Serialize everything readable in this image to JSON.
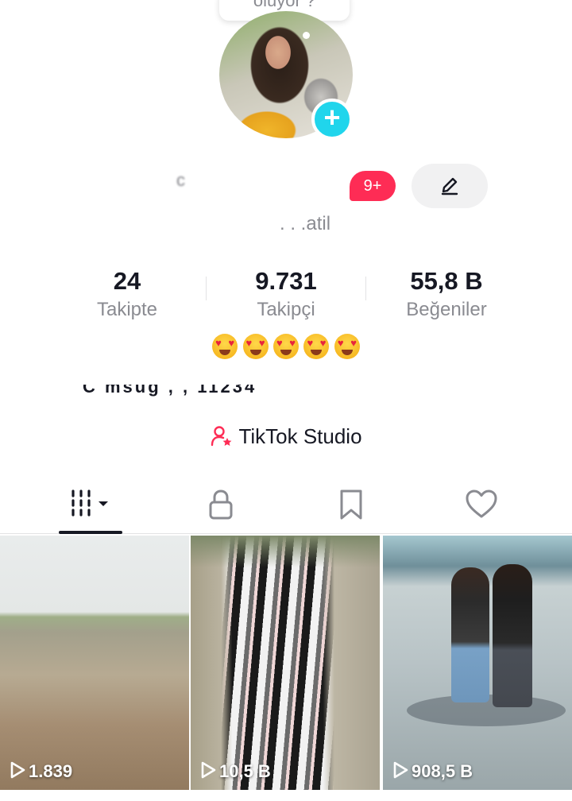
{
  "profile": {
    "note_bubble": "oluyor ?",
    "username": "c   ",
    "notification_badge": "9+",
    "subname": ". . .atil"
  },
  "stats": [
    {
      "value": "24",
      "label": "Takipte"
    },
    {
      "value": "9.731",
      "label": "Takipçi"
    },
    {
      "value": "55,8 B",
      "label": "Beğeniler"
    }
  ],
  "bio": {
    "line2_partial": "C    msug       ,         ,   11234"
  },
  "studio": {
    "label": "TikTok Studio"
  },
  "tabs": [
    {
      "name": "videos",
      "icon": "grid-icon"
    },
    {
      "name": "private",
      "icon": "lock-icon"
    },
    {
      "name": "favorites",
      "icon": "bookmark-icon"
    },
    {
      "name": "liked",
      "icon": "heart-icon"
    }
  ],
  "videos": [
    {
      "views": "1.839"
    },
    {
      "views": "10,5 B"
    },
    {
      "views": "908,5 B"
    }
  ],
  "colors": {
    "accent_red": "#fe2c55",
    "plus_cyan": "#20d5ec",
    "text_primary": "#161823",
    "text_secondary": "#8a8b91"
  }
}
